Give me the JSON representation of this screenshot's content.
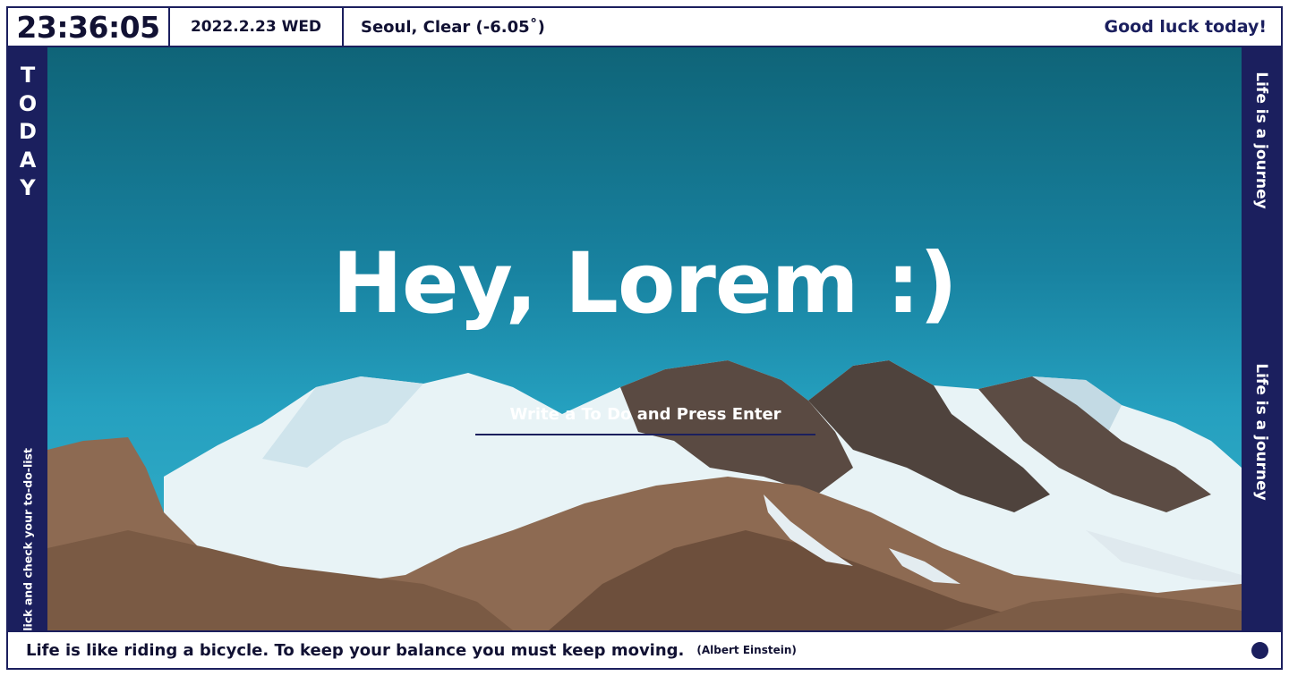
{
  "header": {
    "clock": "23:36:05",
    "date": "2022.2.23 WED",
    "weather": "Seoul, Clear (-6.05˚)",
    "greeting": "Good luck today!"
  },
  "left_panel": {
    "letters": [
      "T",
      "O",
      "D",
      "A",
      "Y"
    ],
    "hint": "Click and check your to-do-list"
  },
  "right_panel": {
    "motto_top": "Life is a journey",
    "motto_bottom": "Life is a journey"
  },
  "main": {
    "headline": "Hey, Lorem :)",
    "todo_placeholder": "Write a To Do and Press Enter",
    "todo_value": ""
  },
  "footer": {
    "quote": "Life is like riding a bicycle. To keep your balance you must keep moving.",
    "author": "(Albert Einstein)"
  },
  "colors": {
    "accent": "#1b1f5e",
    "sky_top": "#0f6478",
    "sky_bottom": "#38b2cb"
  },
  "icons": {
    "status_dot": "circle-icon"
  }
}
